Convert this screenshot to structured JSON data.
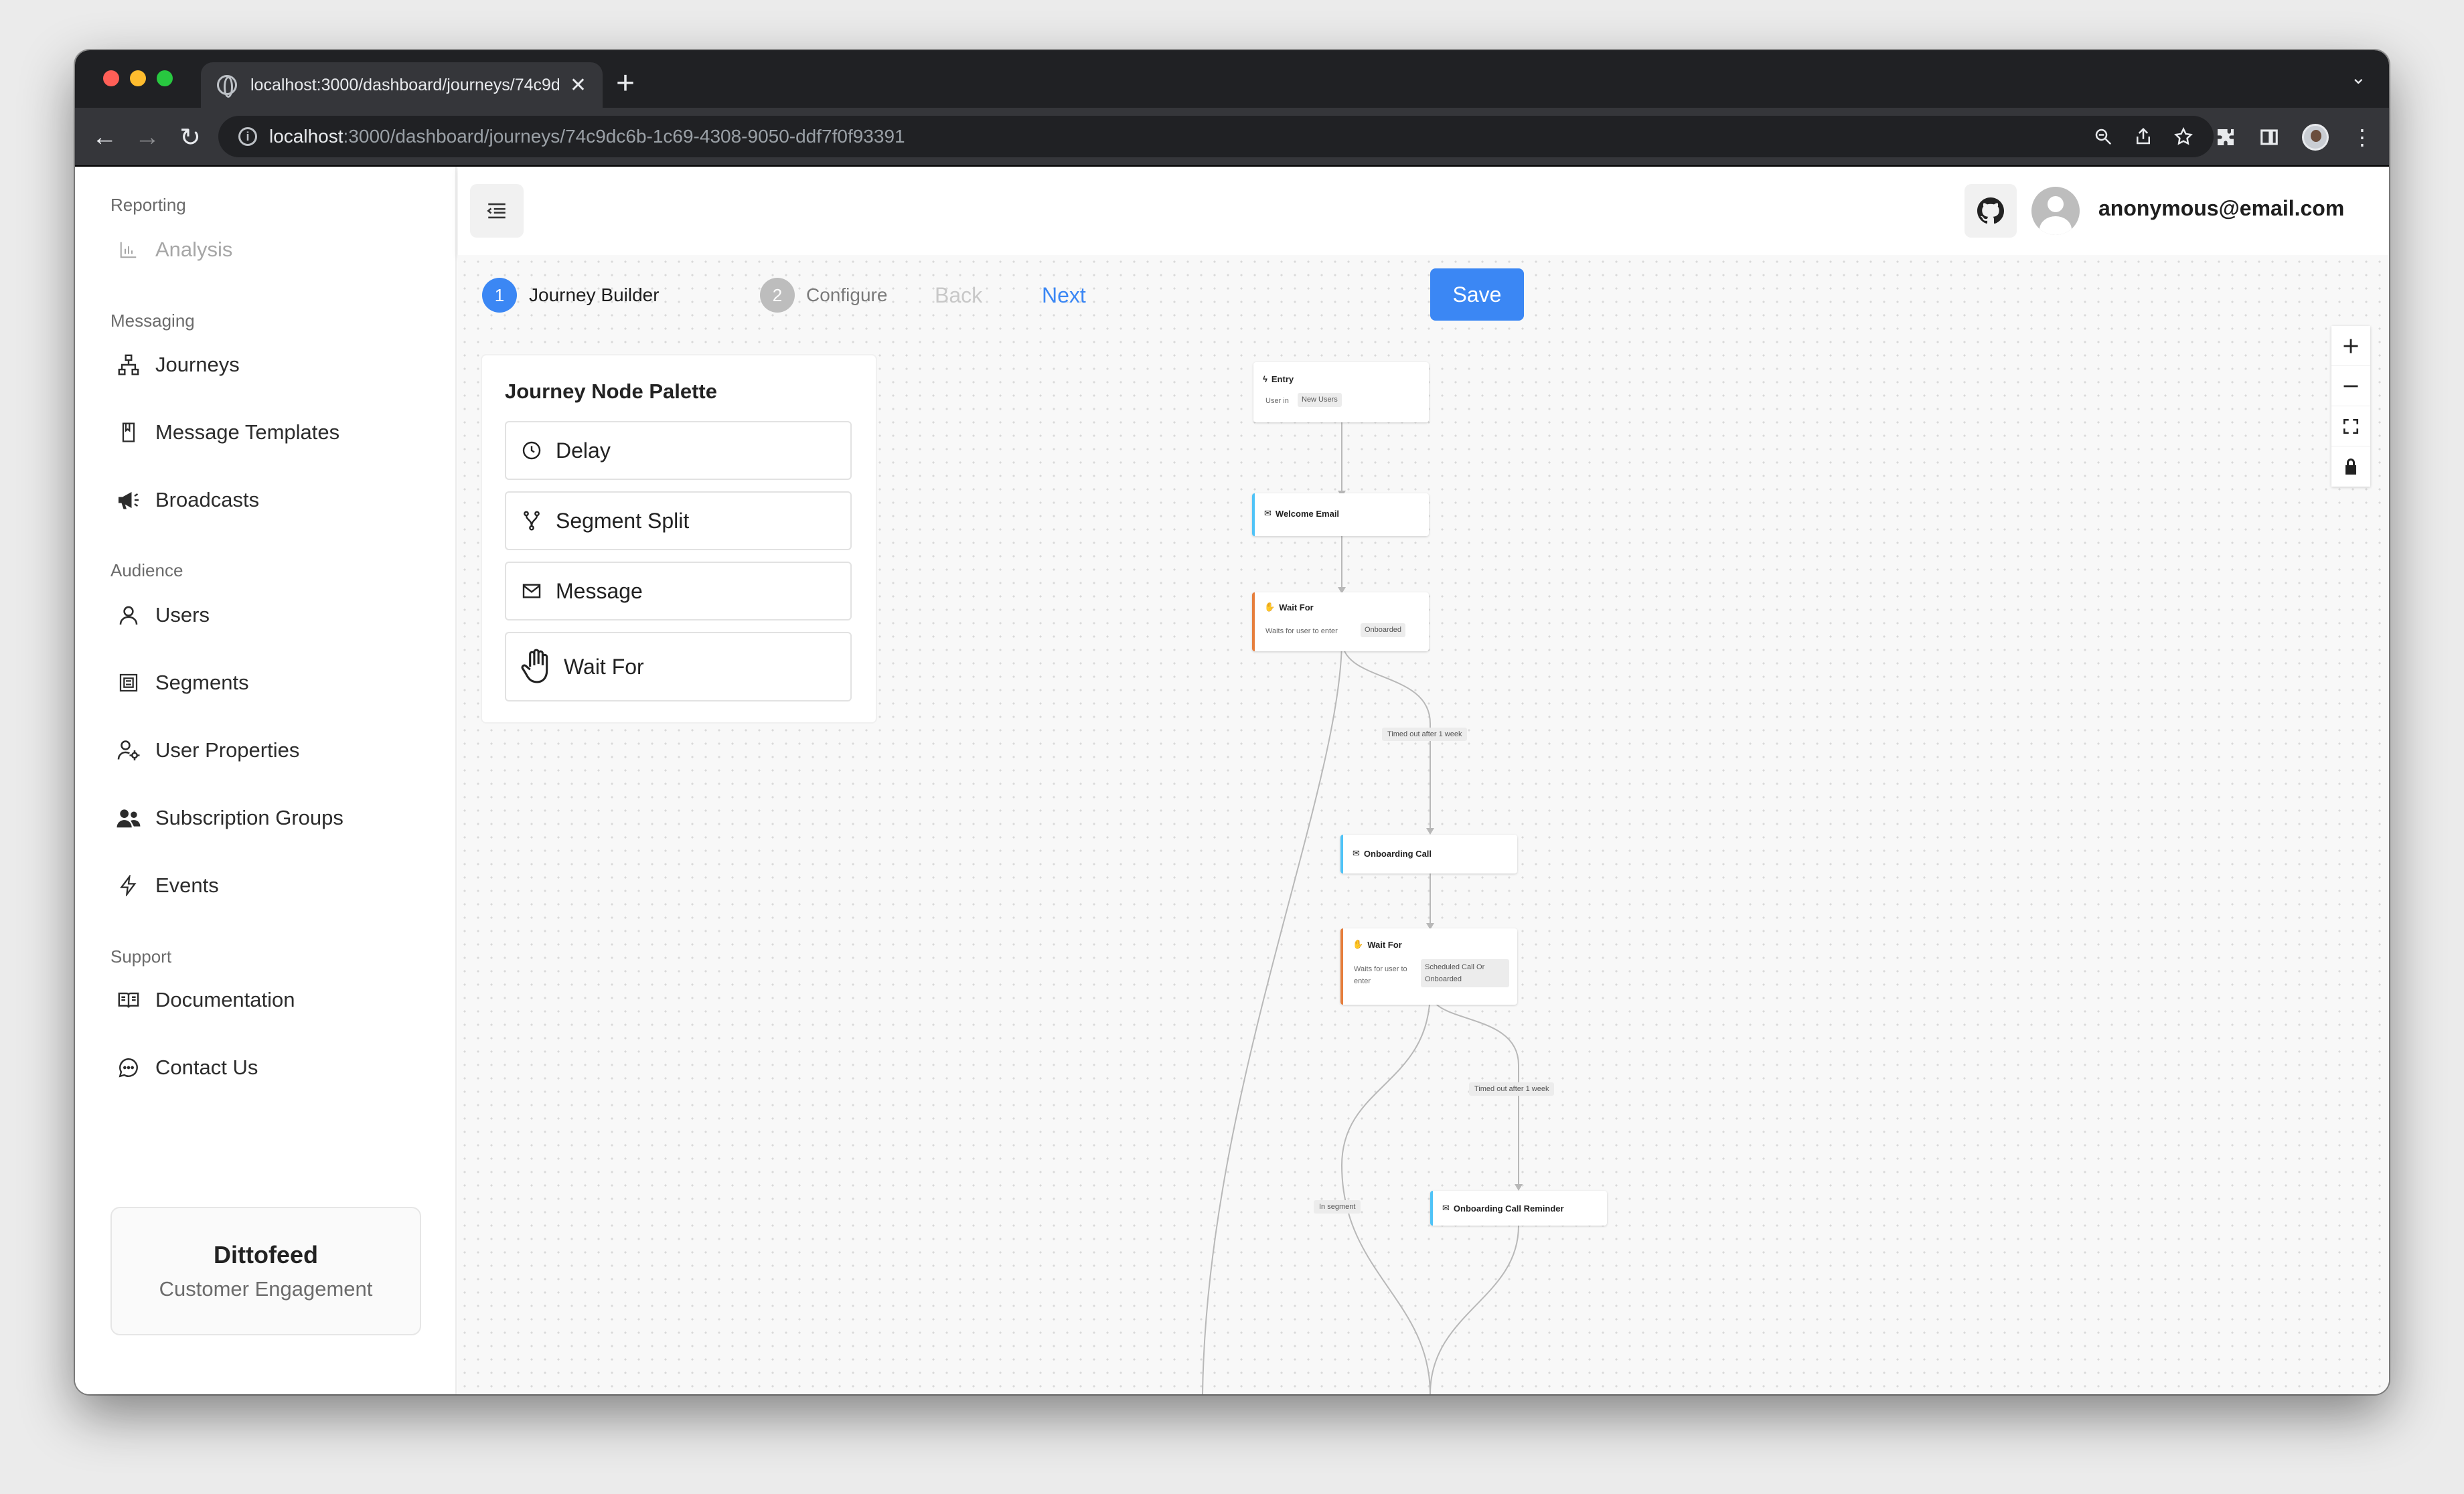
{
  "browser": {
    "tab_title": "localhost:3000/dashboard/journeys/74c9dc6b-1c69-4308-9050-ddf7f0f93391",
    "tab_close": "✕",
    "new_tab": "+",
    "url_host": "localhost",
    "url_path": ":3000/dashboard/journeys/74c9dc6b-1c69-4308-9050-ddf7f0f93391"
  },
  "sidebar": {
    "sections": {
      "reporting": "Reporting",
      "messaging": "Messaging",
      "audience": "Audience",
      "support": "Support"
    },
    "items": {
      "analysis": "Analysis",
      "journeys": "Journeys",
      "message_templates": "Message Templates",
      "broadcasts": "Broadcasts",
      "users": "Users",
      "segments": "Segments",
      "user_properties": "User Properties",
      "subscription_groups": "Subscription Groups",
      "events": "Events",
      "documentation": "Documentation",
      "contact_us": "Contact Us"
    },
    "brand": {
      "name": "Dittofeed",
      "tagline": "Customer Engagement"
    }
  },
  "header": {
    "user_email": "anonymous@email.com"
  },
  "stepper": {
    "step1_number": "1",
    "step1_label": "Journey Builder",
    "step2_number": "2",
    "step2_label": "Configure",
    "back_label": "Back",
    "next_label": "Next",
    "save_label": "Save"
  },
  "palette": {
    "title": "Journey Node Palette",
    "items": [
      "Delay",
      "Segment Split",
      "Message",
      "Wait For"
    ]
  },
  "flow": {
    "entry": {
      "title": "Entry",
      "sub": "User in",
      "chip": "New Users"
    },
    "welcome": {
      "title": "Welcome Email"
    },
    "wait1": {
      "title": "Wait For",
      "sub": "Waits for user to enter",
      "chip": "Onboarded"
    },
    "edge_timeout_1": "Timed out after 1 week",
    "onboarding_call": {
      "title": "Onboarding Call"
    },
    "wait2": {
      "title": "Wait For",
      "sub": "Waits for user to enter",
      "chip": "Scheduled Call Or Onboarded"
    },
    "edge_timeout_2": "Timed out after 1 week",
    "edge_in_segment": "In segment",
    "reminder": {
      "title": "Onboarding Call Reminder"
    }
  },
  "colors": {
    "accent": "#3b87f4",
    "message_node": "#4fc3f7",
    "wait_node": "#e67e3c",
    "inactive_step": "#bdbdbd"
  }
}
